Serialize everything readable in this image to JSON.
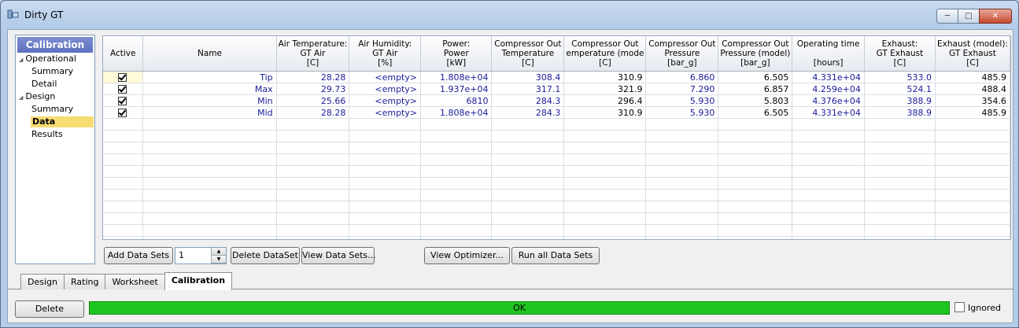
{
  "window": {
    "title": "Dirty GT"
  },
  "nav": {
    "header": "Calibration",
    "items": [
      {
        "label": "Operational",
        "level": 0,
        "expandable": true
      },
      {
        "label": "Summary",
        "level": 1
      },
      {
        "label": "Detail",
        "level": 1
      },
      {
        "label": "Design",
        "level": 0,
        "expandable": true
      },
      {
        "label": "Summary",
        "level": 1
      },
      {
        "label": "Data",
        "level": 1,
        "selected": true
      },
      {
        "label": "Results",
        "level": 1
      }
    ]
  },
  "grid": {
    "columns": [
      {
        "lines": [
          "Active"
        ]
      },
      {
        "lines": [
          "Name"
        ]
      },
      {
        "lines": [
          "Air Temperature:",
          "GT Air",
          "[C]"
        ]
      },
      {
        "lines": [
          "Air Humidity:",
          "GT Air",
          "[%]"
        ]
      },
      {
        "lines": [
          "Power:",
          "Power",
          "[kW]"
        ]
      },
      {
        "lines": [
          "Compressor Out",
          "Temperature",
          "[C]"
        ]
      },
      {
        "lines": [
          "Compressor Out",
          "emperature (mode",
          "[C]"
        ]
      },
      {
        "lines": [
          "Compressor Out",
          "Pressure",
          "[bar_g]"
        ]
      },
      {
        "lines": [
          "Compressor Out",
          "Pressure (model)",
          "[bar_g]"
        ]
      },
      {
        "lines": [
          "Operating time",
          "",
          "[hours]"
        ]
      },
      {
        "lines": [
          "Exhaust:",
          "GT Exhaust",
          "[C]"
        ]
      },
      {
        "lines": [
          "Exhaust (model):",
          "GT Exhaust",
          "[C]"
        ]
      }
    ],
    "rows": [
      {
        "active": true,
        "cells": [
          "Tip",
          "28.28",
          "<empty>",
          "1.808e+04",
          "308.4",
          "310.9",
          "6.860",
          "6.505",
          "4.331e+04",
          "533.0",
          "485.9"
        ]
      },
      {
        "active": true,
        "cells": [
          "Max",
          "29.73",
          "<empty>",
          "1.937e+04",
          "317.1",
          "321.9",
          "7.290",
          "6.857",
          "4.259e+04",
          "524.1",
          "488.4"
        ]
      },
      {
        "active": true,
        "cells": [
          "Min",
          "25.66",
          "<empty>",
          "6810",
          "284.3",
          "296.4",
          "5.930",
          "5.803",
          "4.376e+04",
          "388.9",
          "354.6"
        ]
      },
      {
        "active": true,
        "cells": [
          "Mid",
          "28.28",
          "<empty>",
          "1.808e+04",
          "284.3",
          "310.9",
          "5.930",
          "6.505",
          "4.331e+04",
          "388.9",
          "485.9"
        ]
      }
    ],
    "empty_rows": 11
  },
  "toolbar": {
    "add_data_sets": "Add Data Sets",
    "spin_value": "1",
    "delete_dataset": "Delete DataSet",
    "view_data_sets": "View Data Sets...",
    "view_optimizer": "View Optimizer...",
    "run_all": "Run all Data Sets"
  },
  "tabs": [
    {
      "label": "Design"
    },
    {
      "label": "Rating"
    },
    {
      "label": "Worksheet"
    },
    {
      "label": "Calibration",
      "active": true
    }
  ],
  "bottom": {
    "delete_label": "Delete",
    "status_text": "OK",
    "status_color": "#1fc51f",
    "ignored_label": "Ignored"
  }
}
